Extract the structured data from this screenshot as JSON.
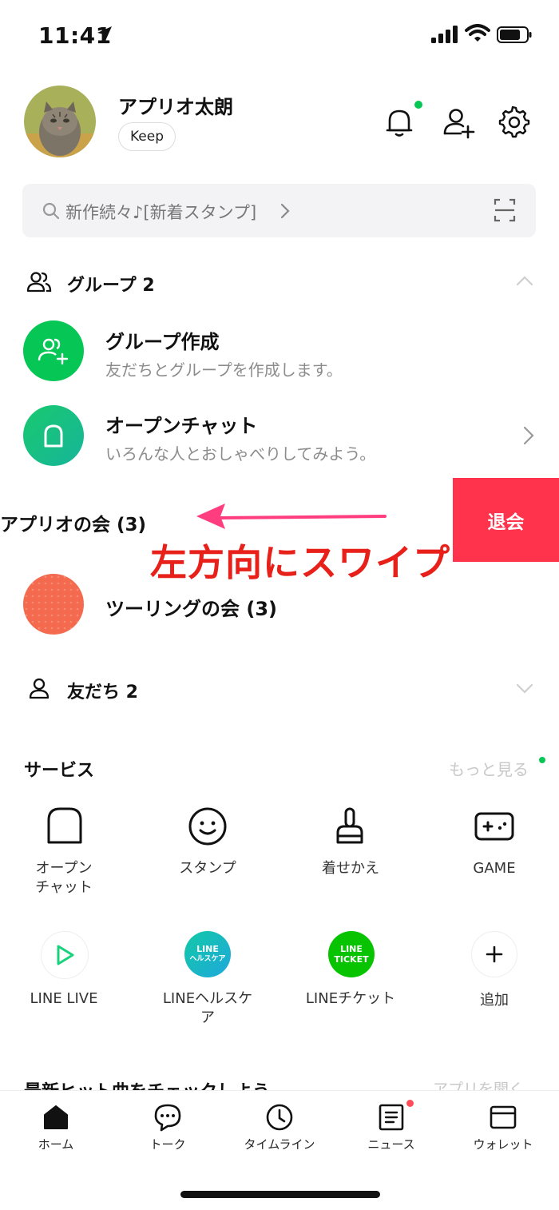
{
  "status_bar": {
    "time": "11:41"
  },
  "profile": {
    "name": "アプリオ太朗",
    "keep_label": "Keep"
  },
  "search": {
    "text": "新作続々♪[新着スタンプ]"
  },
  "groups_section": {
    "title": "グループ 2",
    "create_group": {
      "title": "グループ作成",
      "subtitle": "友だちとグループを作成します。"
    },
    "open_chat": {
      "title": "オープンチャット",
      "subtitle": "いろんな人とおしゃべりしてみよう。"
    },
    "swiped_group": {
      "title": "アプリオの会 (3)"
    },
    "leave_label": "退会",
    "swipe_annotation": "左方向にスワイプ",
    "touring_group": {
      "title": "ツーリングの会 (3)",
      "color": "#f46a4e"
    }
  },
  "friends_section": {
    "title": "友だち 2"
  },
  "services": {
    "title": "サービス",
    "more_label": "もっと見る",
    "items": [
      {
        "label_line1": "オープン",
        "label_line2": "チャット",
        "icon": "open-chat-icon"
      },
      {
        "label_line1": "スタンプ",
        "label_line2": "",
        "icon": "smile-icon"
      },
      {
        "label_line1": "着せかえ",
        "label_line2": "",
        "icon": "brush-icon"
      },
      {
        "label_line1": "GAME",
        "label_line2": "",
        "icon": "game-controller-icon"
      },
      {
        "label_line1": "LINE LIVE",
        "label_line2": "",
        "icon": "play-icon"
      },
      {
        "label_line1": "LINEヘルスケ",
        "label_line2": "ア",
        "icon": "line-healthcare-icon",
        "badge_line1": "LINE",
        "badge_line2": "ヘルスケア"
      },
      {
        "label_line1": "LINEチケット",
        "label_line2": "",
        "icon": "line-ticket-icon",
        "badge_line1": "LINE",
        "badge_line2": "TICKET"
      },
      {
        "label_line1": "追加",
        "label_line2": "",
        "icon": "plus-icon"
      }
    ]
  },
  "promo": {
    "title": "最新ヒット曲をチェックしよう",
    "action": "アプリを開く"
  },
  "tabs": [
    {
      "label": "ホーム",
      "icon": "home-icon"
    },
    {
      "label": "トーク",
      "icon": "chat-icon"
    },
    {
      "label": "タイムライン",
      "icon": "clock-icon"
    },
    {
      "label": "ニュース",
      "icon": "news-icon"
    },
    {
      "label": "ウォレット",
      "icon": "wallet-icon"
    }
  ],
  "colors": {
    "line_green": "#06c755",
    "leave_red": "#ff334b",
    "annotation_red": "#e8201a",
    "notification_dot": "#ff4d5a"
  }
}
